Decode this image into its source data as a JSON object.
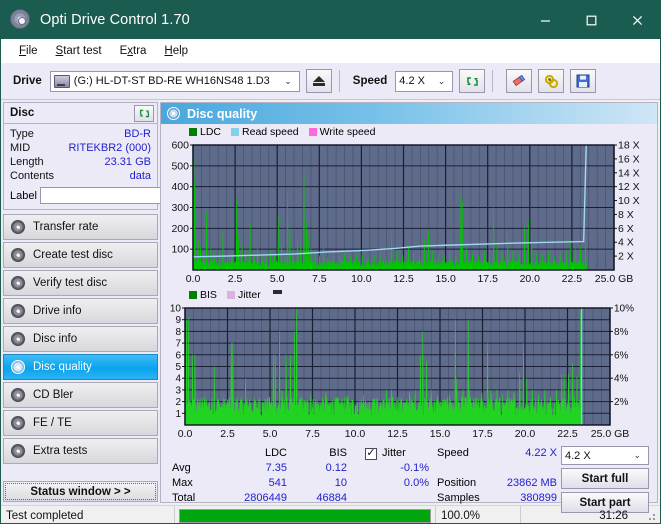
{
  "window": {
    "title": "Opti Drive Control 1.70",
    "icon": "disc-icon",
    "minimize": "–",
    "maximize": "□",
    "close": "✕"
  },
  "menubar": {
    "items": [
      {
        "label": "File",
        "accel": "F"
      },
      {
        "label": "Start test",
        "accel": "S"
      },
      {
        "label": "Extra",
        "accel": "x"
      },
      {
        "label": "Help",
        "accel": "H"
      }
    ]
  },
  "toolbar": {
    "drive_label": "Drive",
    "drive_value": "(G:)  HL-DT-ST BD-RE  WH16NS48 1.D3",
    "eject_title": "eject-button",
    "speed_label": "Speed",
    "speed_value": "4.2 X",
    "refresh_title": "refresh-button",
    "erase_title": "erase-button",
    "settings_title": "settings-button",
    "save_title": "save-button"
  },
  "disc_panel": {
    "title": "Disc",
    "refresh_icon": "refresh-icon",
    "rows": [
      {
        "key": "Type",
        "value": "BD-R"
      },
      {
        "key": "MID",
        "value": "RITEKBR2 (000)"
      },
      {
        "key": "Length",
        "value": "23.31 GB"
      },
      {
        "key": "Contents",
        "value": "data"
      }
    ],
    "label_key": "Label",
    "label_value": "",
    "label_placeholder": ""
  },
  "sidebar": {
    "items": [
      {
        "label": "Transfer rate",
        "selected": false
      },
      {
        "label": "Create test disc",
        "selected": false
      },
      {
        "label": "Verify test disc",
        "selected": false
      },
      {
        "label": "Drive info",
        "selected": false
      },
      {
        "label": "Disc info",
        "selected": false
      },
      {
        "label": "Disc quality",
        "selected": true
      },
      {
        "label": "CD Bler",
        "selected": false
      },
      {
        "label": "FE / TE",
        "selected": false
      },
      {
        "label": "Extra tests",
        "selected": false
      }
    ],
    "status_window_button": "Status window > >"
  },
  "panel": {
    "header_title": "Disc quality",
    "header_icon": "disc-quality-icon"
  },
  "chart_data": [
    {
      "type": "area",
      "name": "ldc-chart",
      "title": "",
      "xlabel": "GB",
      "ylabel": "",
      "legend": [
        {
          "label": "LDC",
          "color": "#008000"
        },
        {
          "label": "Read speed",
          "color": "#87ceeb"
        },
        {
          "label": "Write speed",
          "color": "#ff69dc"
        }
      ],
      "legend_position": "top-left",
      "grid": true,
      "xlim": [
        0,
        25.0
      ],
      "xticks": [
        "0.0",
        "2.5",
        "5.0",
        "7.5",
        "10.0",
        "12.5",
        "15.0",
        "17.5",
        "20.0",
        "22.5",
        "25.0"
      ],
      "xunit": "GB",
      "ylim": [
        0,
        600
      ],
      "yticks": [
        "100",
        "200",
        "300",
        "400",
        "500",
        "600"
      ],
      "y2lim": [
        0,
        18
      ],
      "y2ticks": [
        "2 X",
        "4 X",
        "6 X",
        "8 X",
        "10 X",
        "12 X",
        "14 X",
        "16 X",
        "18 X"
      ],
      "series": [
        {
          "name": "LDC",
          "color": "#00c800",
          "baseline": 28,
          "spikes": [
            [
              0.05,
              540
            ],
            [
              0.12,
              415
            ],
            [
              0.3,
              150
            ],
            [
              0.45,
              120
            ],
            [
              0.62,
              90
            ],
            [
              0.8,
              285
            ],
            [
              1.05,
              110
            ],
            [
              1.25,
              80
            ],
            [
              1.55,
              95
            ],
            [
              1.78,
              185
            ],
            [
              2.05,
              70
            ],
            [
              2.3,
              85
            ],
            [
              2.58,
              338
            ],
            [
              2.7,
              160
            ],
            [
              2.92,
              120
            ],
            [
              3.15,
              95
            ],
            [
              3.4,
              230
            ],
            [
              3.62,
              78
            ],
            [
              3.85,
              110
            ],
            [
              4.1,
              85
            ],
            [
              4.35,
              70
            ],
            [
              4.6,
              95
            ],
            [
              4.85,
              75
            ],
            [
              5.05,
              258
            ],
            [
              5.25,
              130
            ],
            [
              5.48,
              88
            ],
            [
              5.62,
              375
            ],
            [
              5.75,
              200
            ],
            [
              5.95,
              110
            ],
            [
              6.2,
              150
            ],
            [
              6.4,
              120
            ],
            [
              6.6,
              462
            ],
            [
              6.72,
              230
            ],
            [
              6.85,
              170
            ],
            [
              7.02,
              105
            ],
            [
              7.25,
              95
            ],
            [
              7.5,
              70
            ],
            [
              7.75,
              108
            ],
            [
              8.0,
              62
            ],
            [
              8.35,
              80
            ],
            [
              8.7,
              70
            ],
            [
              9.0,
              90
            ],
            [
              9.35,
              65
            ],
            [
              9.7,
              75
            ],
            [
              10.05,
              85
            ],
            [
              10.4,
              60
            ],
            [
              10.75,
              70
            ],
            [
              11.1,
              88
            ],
            [
              11.45,
              62
            ],
            [
              11.8,
              195
            ],
            [
              12.1,
              90
            ],
            [
              12.45,
              75
            ],
            [
              12.8,
              118
            ],
            [
              13.1,
              82
            ],
            [
              13.45,
              70
            ],
            [
              13.75,
              150
            ],
            [
              14.0,
              190
            ],
            [
              14.25,
              95
            ],
            [
              14.55,
              80
            ],
            [
              14.9,
              72
            ],
            [
              15.25,
              88
            ],
            [
              15.6,
              78
            ],
            [
              15.9,
              362
            ],
            [
              16.0,
              330
            ],
            [
              16.25,
              105
            ],
            [
              16.6,
              80
            ],
            [
              16.95,
              70
            ],
            [
              17.3,
              95
            ],
            [
              17.6,
              112
            ],
            [
              17.85,
              300
            ],
            [
              18.05,
              130
            ],
            [
              18.35,
              90
            ],
            [
              18.7,
              175
            ],
            [
              19.0,
              95
            ],
            [
              19.35,
              80
            ],
            [
              19.7,
              205
            ],
            [
              19.92,
              242
            ],
            [
              20.1,
              175
            ],
            [
              20.4,
              85
            ],
            [
              20.75,
              75
            ],
            [
              21.1,
              90
            ],
            [
              21.45,
              70
            ],
            [
              21.8,
              80
            ],
            [
              22.15,
              95
            ],
            [
              22.45,
              148
            ],
            [
              22.7,
              105
            ],
            [
              23.0,
              120
            ],
            [
              23.3,
              165
            ]
          ]
        },
        {
          "name": "Read speed",
          "color": "#9fd8f2",
          "points": [
            [
              0.0,
              1.9
            ],
            [
              2.0,
              2.0
            ],
            [
              4.0,
              2.15
            ],
            [
              6.0,
              2.3
            ],
            [
              8.0,
              2.6
            ],
            [
              10.0,
              2.8
            ],
            [
              12.0,
              3.1
            ],
            [
              13.5,
              3.45
            ],
            [
              15.5,
              3.6
            ],
            [
              17.5,
              3.75
            ],
            [
              19.5,
              3.9
            ],
            [
              21.5,
              4.0
            ],
            [
              23.2,
              4.1
            ],
            [
              23.35,
              18.0
            ]
          ]
        }
      ]
    },
    {
      "type": "area",
      "name": "bis-chart",
      "title": "",
      "xlabel": "GB",
      "legend": [
        {
          "label": "BIS",
          "color": "#008000"
        },
        {
          "label": "Jitter",
          "color": "#d9b3e0"
        }
      ],
      "legend_position": "top-left",
      "grid": true,
      "xlim": [
        0,
        25.0
      ],
      "xticks": [
        "0.0",
        "2.5",
        "5.0",
        "7.5",
        "10.0",
        "12.5",
        "15.0",
        "17.5",
        "20.0",
        "22.5",
        "25.0"
      ],
      "xunit": "GB",
      "ylim": [
        0,
        10
      ],
      "yticks": [
        "1",
        "2",
        "3",
        "4",
        "5",
        "6",
        "7",
        "8",
        "9",
        "10"
      ],
      "y2lim": [
        0,
        10
      ],
      "y2ticks": [
        "2%",
        "4%",
        "6%",
        "8%",
        "10%"
      ],
      "series": [
        {
          "name": "BIS",
          "color": "#22d422",
          "baseline": 1.5,
          "spikes": [
            [
              0.08,
              9.0
            ],
            [
              0.2,
              9.2
            ],
            [
              0.45,
              6.0
            ],
            [
              0.58,
              6.0
            ],
            [
              0.9,
              2.2
            ],
            [
              1.18,
              2.4
            ],
            [
              1.45,
              2.0
            ],
            [
              1.72,
              5.0
            ],
            [
              1.95,
              2.3
            ],
            [
              2.25,
              2.0
            ],
            [
              2.5,
              2.2
            ],
            [
              2.72,
              7.0
            ],
            [
              2.8,
              7.0
            ],
            [
              3.05,
              2.4
            ],
            [
              3.3,
              2.0
            ],
            [
              3.55,
              4.0
            ],
            [
              3.8,
              2.2
            ],
            [
              4.1,
              2.0
            ],
            [
              4.4,
              2.3
            ],
            [
              4.7,
              2.0
            ],
            [
              4.95,
              2.4
            ],
            [
              5.2,
              6.0
            ],
            [
              5.3,
              6.0
            ],
            [
              5.55,
              8.0
            ],
            [
              5.7,
              3.0
            ],
            [
              5.95,
              6.0
            ],
            [
              6.2,
              6.0
            ],
            [
              6.45,
              8.0
            ],
            [
              6.55,
              10.0
            ],
            [
              6.85,
              2.5
            ],
            [
              7.1,
              2.0
            ],
            [
              7.4,
              2.6
            ],
            [
              7.7,
              2.2
            ],
            [
              8.0,
              2.0
            ],
            [
              8.3,
              2.8
            ],
            [
              8.6,
              2.0
            ],
            [
              8.95,
              2.3
            ],
            [
              9.25,
              2.0
            ],
            [
              9.55,
              2.5
            ],
            [
              9.85,
              2.1
            ],
            [
              10.15,
              2.0
            ],
            [
              10.5,
              2.6
            ],
            [
              10.85,
              2.0
            ],
            [
              11.15,
              2.2
            ],
            [
              11.5,
              2.0
            ],
            [
              11.85,
              3.0
            ],
            [
              12.15,
              3.0
            ],
            [
              12.5,
              2.4
            ],
            [
              12.85,
              2.0
            ],
            [
              13.2,
              2.8
            ],
            [
              13.55,
              3.0
            ],
            [
              13.85,
              6.0
            ],
            [
              14.0,
              8.0
            ],
            [
              14.2,
              5.5
            ],
            [
              14.5,
              3.0
            ],
            [
              14.85,
              2.5
            ],
            [
              15.2,
              2.0
            ],
            [
              15.55,
              2.6
            ],
            [
              15.9,
              9.0
            ],
            [
              16.0,
              4.0
            ],
            [
              16.35,
              3.0
            ],
            [
              16.65,
              9.0
            ],
            [
              16.75,
              3.0
            ],
            [
              17.1,
              2.4
            ],
            [
              17.45,
              2.8
            ],
            [
              17.8,
              7.0
            ],
            [
              18.0,
              3.0
            ],
            [
              18.35,
              3.0
            ],
            [
              18.7,
              2.6
            ],
            [
              19.0,
              3.0
            ],
            [
              19.35,
              2.8
            ],
            [
              19.7,
              4.5
            ],
            [
              19.9,
              7.0
            ],
            [
              20.1,
              4.0
            ],
            [
              20.45,
              3.0
            ],
            [
              20.8,
              2.6
            ],
            [
              21.15,
              3.0
            ],
            [
              21.5,
              2.4
            ],
            [
              21.85,
              3.0
            ],
            [
              22.15,
              4.3
            ],
            [
              22.3,
              4.3
            ],
            [
              22.55,
              4.4
            ],
            [
              22.8,
              5.2
            ],
            [
              23.05,
              4.2
            ],
            [
              23.28,
              9.8
            ]
          ]
        }
      ]
    }
  ],
  "stats": {
    "col_headers": [
      "LDC",
      "BIS"
    ],
    "rows": [
      {
        "label": "Avg",
        "ldc": "7.35",
        "bis": "0.12"
      },
      {
        "label": "Max",
        "ldc": "541",
        "bis": "10"
      },
      {
        "label": "Total",
        "ldc": "2806449",
        "bis": "46884"
      }
    ],
    "jitter": {
      "checked": true,
      "label": "Jitter",
      "avg": "-0.1%",
      "max": "0.0%"
    },
    "right": [
      {
        "label": "Speed",
        "value": "4.22 X"
      },
      {
        "label": "Position",
        "value": "23862 MB"
      },
      {
        "label": "Samples",
        "value": "380899"
      }
    ],
    "speed_select": "4.2 X",
    "start_full": "Start full",
    "start_part": "Start part"
  },
  "statusbar": {
    "message": "Test completed",
    "progress_percent": 100.0,
    "progress_text": "100.0%",
    "elapsed": "31:26"
  },
  "colors": {
    "title_bar": "#1b5c51",
    "accent": "#0aa3ee",
    "plot_bg": "#5f6b8a",
    "ldc_green": "#00c800",
    "read_speed": "#9fd8f2",
    "write_speed": "#ff69dc",
    "value_blue": "#2222cc",
    "progress_green": "#00a60e"
  }
}
